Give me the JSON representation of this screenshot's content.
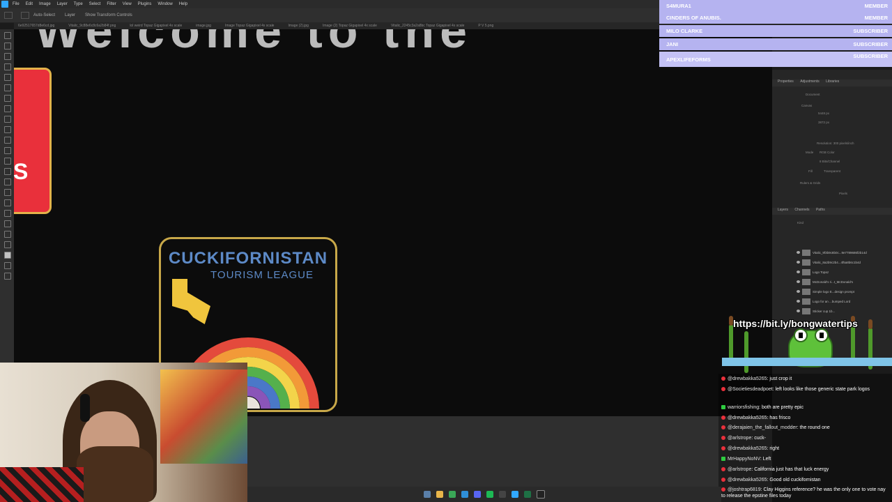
{
  "app": {
    "menu": [
      "File",
      "Edit",
      "Image",
      "Layer",
      "Type",
      "Select",
      "Filter",
      "View",
      "Plugins",
      "Window",
      "Help"
    ],
    "options": {
      "auto_select": "Auto-Select",
      "layer": "Layer",
      "show_transform": "Show Transform Controls"
    },
    "tabs": [
      "6e92517657d8e6cd.jpg",
      "Vitalic_9c88e6c8c6a2b84f.png",
      "lol weird Topaz Gigapixel 4x scale",
      "image.jpg",
      "Image Topaz Gigapixel 4x scale",
      "Image (2).jpg",
      "Image (2) Topaz Gigapixel 4x scale",
      "Vitalic_2245c3a2a8bc Topaz Gigapixel 4x scale",
      "P V 5.png"
    ]
  },
  "canvas": {
    "big_text": "Welcome to the",
    "badge_letter": "S",
    "logo_title": "CUCKIFORNISTAN",
    "logo_subtitle": "TOURISM LEAGUE"
  },
  "properties_panel": {
    "tabs": [
      "Properties",
      "Adjustments",
      "Libraries"
    ],
    "document_label": "Document",
    "canvas_label": "Canvas",
    "width": "5448 px",
    "height": "3872 px",
    "resolution": "Resolution: 300 pixels/inch",
    "mode_label": "Mode",
    "mode_value": "RGB Color",
    "depth": "8 Bits/Channel",
    "fill_label": "Fill",
    "fill_value": "Transparent",
    "rulers": "Rulers & Grids",
    "units": "Pixels"
  },
  "layers_panel": {
    "tabs": [
      "Layers",
      "Channels",
      "Paths"
    ],
    "kind": "Kind",
    "layers": [
      "Vitalic_9f3b9c8b0c...9e7789686f2b14d",
      "Vitalic_8a2b9c2b4...4f5a8b6c1b4d",
      "Logo Topaz",
      "McDonald's ri...t_McDonald's",
      "Simple logo E...design prompt",
      "Logo for an ...bumped Lord",
      "Sticker cup 1b..."
    ]
  },
  "alerts": [
    {
      "name": "S4MURA1",
      "tier": "MEMBER"
    },
    {
      "name": "CINDERS OF ANUBIS.",
      "tier": "MEMBER"
    },
    {
      "name": "MILO CLARKE",
      "tier": "SUBSCRIBER"
    },
    {
      "name": "JANI",
      "tier": "SUBSCRIBER"
    },
    {
      "name": "APEXLIFEFORMS",
      "tier": "SUBSCRIBER"
    }
  ],
  "banner": {
    "url": "https://bit.ly/bongwatertips"
  },
  "chat": [
    {
      "user": "@drewbakka5265",
      "text": "just crop it",
      "badge": "red"
    },
    {
      "user": "@Societiesdeadpoet",
      "text": "left looks like those generic state park logos",
      "badge": "red"
    },
    {
      "user": "warriorsfishing",
      "text": "both are pretty epic",
      "badge": "green"
    },
    {
      "user": "@drewbakka5265",
      "text": "has frisco",
      "badge": "red"
    },
    {
      "user": "@derajaien_the_fallout_modder",
      "text": "the round one",
      "badge": "red"
    },
    {
      "user": "@arlstrope",
      "text": "cuck-",
      "badge": "red"
    },
    {
      "user": "@drewbakka5265",
      "text": "right",
      "badge": "red"
    },
    {
      "user": "MrHappyNoNV",
      "text": "Left",
      "badge": "green"
    },
    {
      "user": "@arlstrope",
      "text": "California just has that luck energy",
      "badge": "red"
    },
    {
      "user": "@drewbakka5265",
      "text": "Good old cuckifornistan",
      "badge": "red"
    },
    {
      "user": "@joshtrap6819",
      "text": "Clay Higgins reference? he was the only one to vote nay to release the epstine files today",
      "badge": "red"
    }
  ],
  "colors": {
    "alert_bg": "#b5b3f0",
    "badge_red": "#e9303b",
    "logo_gold": "#c8a849",
    "logo_blue": "#5d8ac7"
  },
  "taskbar_icons": [
    "steam-icon",
    "folder-icon",
    "chrome-icon",
    "edge-icon",
    "discord-icon",
    "spotify-icon",
    "obs-icon",
    "photoshop-icon",
    "excel-icon",
    "terminal-icon"
  ]
}
